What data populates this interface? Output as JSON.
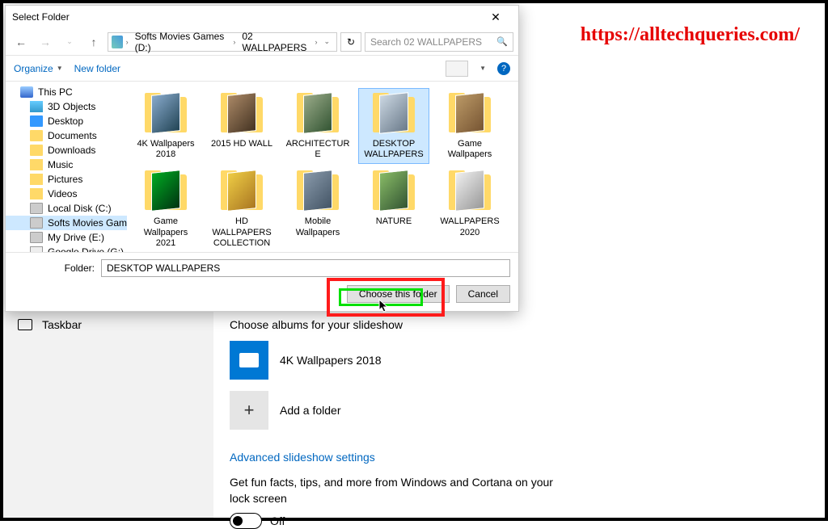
{
  "watermark": "https://alltechqueries.com/",
  "dialog": {
    "title": "Select Folder",
    "close": "✕",
    "breadcrumb": {
      "seg1": "Softs Movies Games (D:)",
      "seg2": "02 WALLPAPERS"
    },
    "search_placeholder": "Search 02 WALLPAPERS",
    "toolbar": {
      "organize": "Organize",
      "new_folder": "New folder",
      "help": "?"
    },
    "tree": [
      {
        "label": "This PC",
        "iconClass": "pc"
      },
      {
        "label": "3D Objects",
        "iconClass": "cube",
        "indent": true
      },
      {
        "label": "Desktop",
        "iconClass": "desk",
        "indent": true
      },
      {
        "label": "Documents",
        "iconClass": "folder",
        "indent": true
      },
      {
        "label": "Downloads",
        "iconClass": "folder",
        "indent": true
      },
      {
        "label": "Music",
        "iconClass": "music",
        "indent": true
      },
      {
        "label": "Pictures",
        "iconClass": "pic",
        "indent": true
      },
      {
        "label": "Videos",
        "iconClass": "vid",
        "indent": true
      },
      {
        "label": "Local Disk (C:)",
        "iconClass": "disk",
        "indent": true
      },
      {
        "label": "Softs Movies Games (D:)",
        "iconClass": "disk",
        "indent": true,
        "selected": true
      },
      {
        "label": "My Drive (E:)",
        "iconClass": "disk",
        "indent": true
      },
      {
        "label": "Google Drive (G:)",
        "iconClass": "drive",
        "indent": true
      }
    ],
    "folders": [
      {
        "label": "4K Wallpapers 2018",
        "c": "c1"
      },
      {
        "label": "2015 HD WALL",
        "c": "c2"
      },
      {
        "label": "ARCHITECTURE",
        "c": "c3"
      },
      {
        "label": "DESKTOP WALLPAPERS",
        "c": "c4",
        "selected": true
      },
      {
        "label": "Game Wallpapers",
        "c": "c5"
      },
      {
        "label": "Game Wallpapers 2021",
        "c": "c6"
      },
      {
        "label": "HD WALLPAPERS COLLECTION",
        "c": "c7"
      },
      {
        "label": "Mobile Wallpapers",
        "c": "c8"
      },
      {
        "label": "NATURE",
        "c": "c9"
      },
      {
        "label": "WALLPAPERS 2020",
        "c": "c10"
      }
    ],
    "folder_label": "Folder:",
    "folder_value": "DESKTOP WALLPAPERS",
    "choose_btn": "Choose this folder",
    "cancel_btn": "Cancel"
  },
  "settings": {
    "taskbar": "Taskbar",
    "choose_albums": "Choose albums for your slideshow",
    "album1": "4K Wallpapers 2018",
    "add_folder": "Add a folder",
    "advanced": "Advanced slideshow settings",
    "tip": "Get fun facts, tips, and more from Windows and Cortana on your lock screen",
    "toggle_state": "Off"
  }
}
